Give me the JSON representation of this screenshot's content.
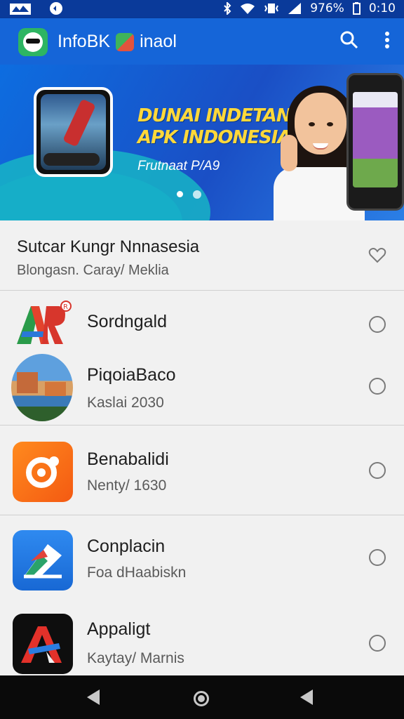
{
  "status_bar": {
    "battery": "976%",
    "time": "0:10"
  },
  "app_bar": {
    "title": "InfoBK",
    "title_suffix": "inaol",
    "search_icon": "search-icon",
    "menu_icon": "more-vert-icon",
    "color": "#1565d8"
  },
  "banner": {
    "headline_line1": "DUNAI INDETANA",
    "headline_line2": "APK INDONESIA",
    "subtitle": "Frutnaat P/A9",
    "headline_color": "#ffd83a",
    "page_count": 2,
    "active_page": 1
  },
  "list": {
    "header_item": {
      "title": "Sutcar Kungr Nnnasesia",
      "subtitle": "Blongasn. Caray/ Meklia"
    },
    "items": [
      {
        "title": "Sordngald",
        "subtitle": "",
        "icon": "ar-logo-icon"
      },
      {
        "title": "PiqoiaBaco",
        "subtitle": "Kaslai 2030",
        "icon": "landscape-photo-icon"
      },
      {
        "title": "Benabalidi",
        "subtitle": "Nenty/ 1630",
        "icon": "orange-badge-icon"
      },
      {
        "title": "Conplacin",
        "subtitle": "Foa dHaabiskn",
        "icon": "blue-book-icon"
      },
      {
        "title": "Appaligt",
        "subtitle": "Kaytay/ Marnis",
        "icon": "red-a-icon"
      }
    ]
  },
  "nav_bar": {
    "back_icon": "back-icon",
    "home_icon": "home-icon",
    "recents_icon": "recents-icon"
  }
}
